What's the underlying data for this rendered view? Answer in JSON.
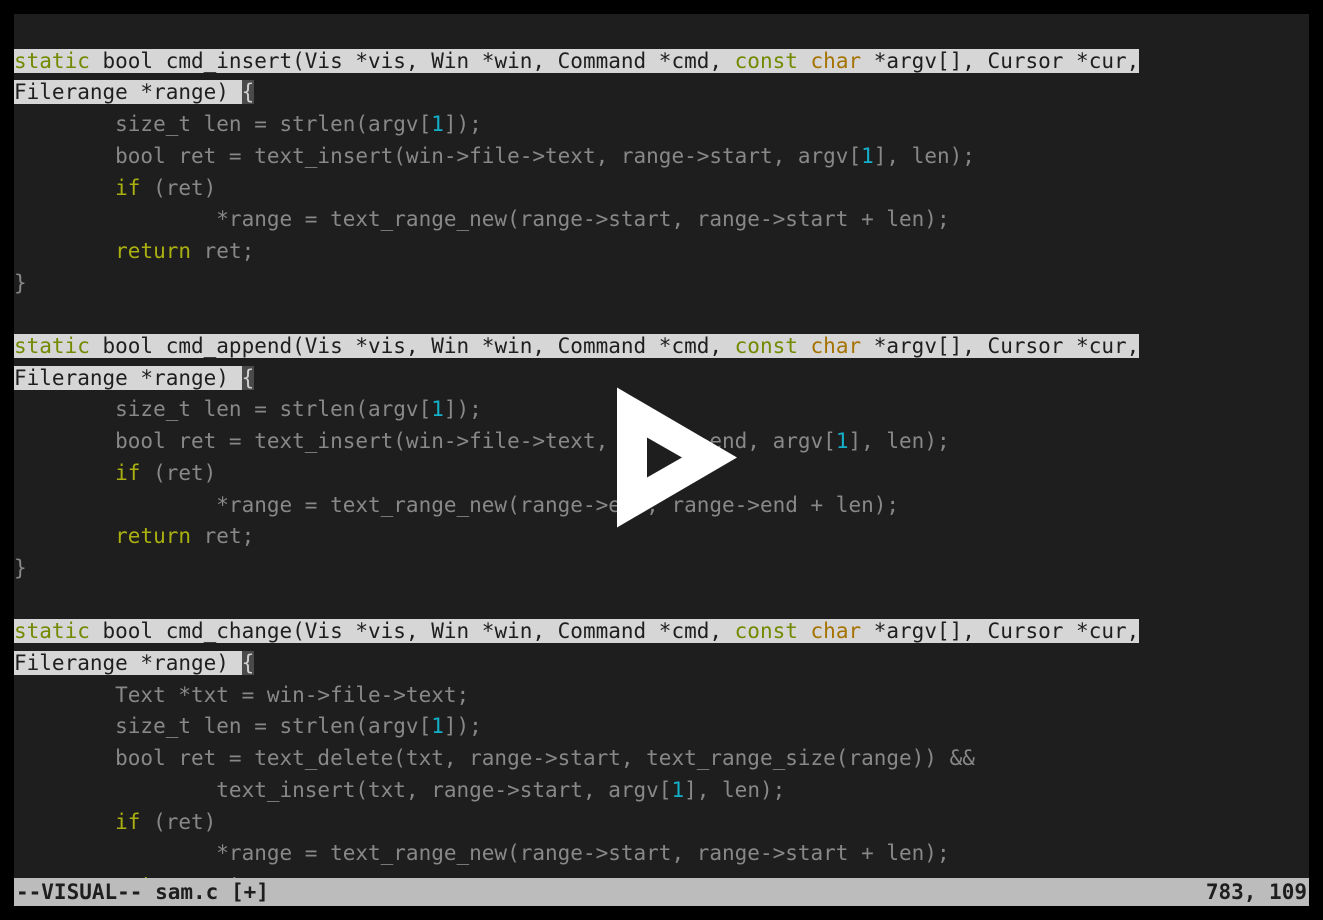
{
  "status": {
    "mode": "--VISUAL--",
    "filename": "sam.c",
    "modified": "[+]",
    "position": "783, 109"
  },
  "code": {
    "func1": {
      "sig_a": "static",
      "sig_b": " bool cmd_insert(Vis *vis, Win *win, Command *cmd, ",
      "sig_c": "const",
      "sig_d": " ",
      "sig_e": "char",
      "sig_f": " *argv",
      "sig_g": "[]",
      "sig_h": ", Cursor *cur,",
      "sig2_a": "Filerange *range) ",
      "brace": "{",
      "l1a": "        size_t len = strlen(argv[",
      "l1b": "1",
      "l1c": "]);",
      "l2a": "        bool ret = text_insert(win->file->text, range->start, argv[",
      "l2b": "1",
      "l2c": "], len);",
      "l3a": "        ",
      "l3b": "if",
      "l3c": " (ret)",
      "l4": "                *range = text_range_new(range->start, range->start + len);",
      "l5a": "        ",
      "l5b": "return",
      "l5c": " ret;",
      "close": "}"
    },
    "func2": {
      "sig_a": "static",
      "sig_b": " bool cmd_append(Vis *vis, Win *win, Command *cmd, ",
      "sig_c": "const",
      "sig_d": " ",
      "sig_e": "char",
      "sig_f": " *argv",
      "sig_g": "[]",
      "sig_h": ", Cursor *cur,",
      "sig2_a": "Filerange *range) ",
      "brace": "{",
      "l1a": "        size_t len = strlen(argv[",
      "l1b": "1",
      "l1c": "]);",
      "l2a": "        bool ret = text_insert(win->file->text, range->end, argv[",
      "l2b": "1",
      "l2c": "], len);",
      "l3a": "        ",
      "l3b": "if",
      "l3c": " (ret)",
      "l4": "                *range = text_range_new(range->end, range->end + len);",
      "l5a": "        ",
      "l5b": "return",
      "l5c": " ret;",
      "close": "}"
    },
    "func3": {
      "sig_a": "static",
      "sig_b": " bool cmd_change(Vis *vis, Win *win, Command *cmd, ",
      "sig_c": "const",
      "sig_d": " ",
      "sig_e": "char",
      "sig_f": " *argv",
      "sig_g": "[]",
      "sig_h": ", Cursor *cur,",
      "sig2_a": "Filerange *range) ",
      "brace": "{",
      "l0": "        Text *txt = win->file->text;",
      "l1a": "        size_t len = strlen(argv[",
      "l1b": "1",
      "l1c": "]);",
      "l2a": "        bool ret = text_delete(txt, range->start, text_range_size(range)) &&",
      "l2b": "                text_insert(txt, range->start, argv[",
      "l2c": "1",
      "l2d": "], len);",
      "l3a": "        ",
      "l3b": "if",
      "l3c": " (ret)",
      "l4": "                *range = text_range_new(range->start, range->start + len);",
      "l5a": "        ",
      "l5b": "return",
      "l5c": " ret;"
    }
  },
  "overlay": {
    "play_icon": "play"
  }
}
